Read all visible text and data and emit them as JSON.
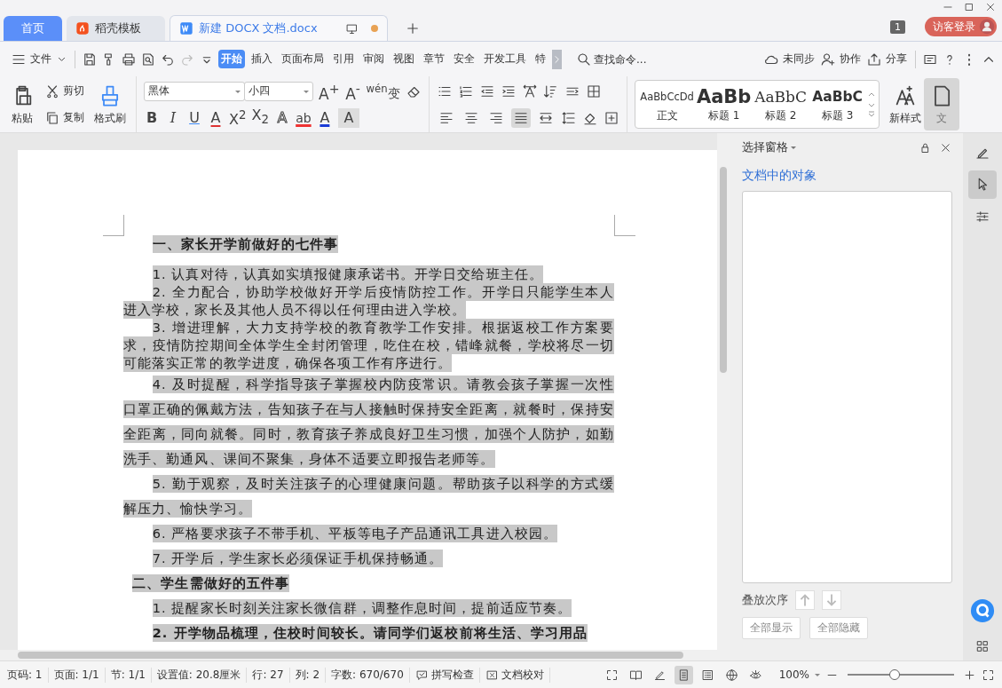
{
  "tabs": [
    {
      "label": "首页",
      "kind": "home",
      "selected": false,
      "modified": false
    },
    {
      "label": "稻壳模板",
      "kind": "template",
      "selected": false,
      "modified": false
    },
    {
      "label": "新建 DOCX 文档.docx",
      "kind": "doc",
      "selected": true,
      "modified": true
    }
  ],
  "window_count": "1",
  "login": "访客登录",
  "menu": {
    "file": "文件",
    "tabs": [
      {
        "label": "开始",
        "selected": true
      },
      {
        "label": "插入",
        "selected": false
      },
      {
        "label": "页面布局",
        "selected": false
      },
      {
        "label": "引用",
        "selected": false
      },
      {
        "label": "审阅",
        "selected": false
      },
      {
        "label": "视图",
        "selected": false
      },
      {
        "label": "章节",
        "selected": false
      },
      {
        "label": "安全",
        "selected": false
      },
      {
        "label": "开发工具",
        "selected": false
      },
      {
        "label": "特",
        "selected": false
      }
    ],
    "search_placeholder": "查找命令...",
    "sync": "未同步",
    "collab": "协作",
    "share": "分享"
  },
  "ribbon": {
    "paste": "粘贴",
    "cut": "剪切",
    "copy": "复制",
    "painter": "格式刷",
    "font": "黑体",
    "size": "小四",
    "font_tools": [
      {
        "kind": "grow",
        "glyph": "A$^{+}$"
      },
      {
        "kind": "shrink",
        "glyph": "A$^{-}$"
      },
      {
        "kind": "pinyin",
        "glyph": "$^{wén}$变"
      }
    ],
    "format": [
      {
        "kind": "bold",
        "glyph": "B"
      },
      {
        "kind": "italic",
        "glyph": "I"
      },
      {
        "kind": "underline",
        "glyph": "U"
      },
      {
        "kind": "strike",
        "glyph": "A"
      },
      {
        "kind": "super",
        "glyph": "X$^{2}$"
      },
      {
        "kind": "sub",
        "glyph": "X$_{2}$"
      },
      {
        "kind": "outline",
        "glyph": "A"
      },
      {
        "kind": "highlight",
        "glyph": "ab"
      },
      {
        "kind": "color",
        "glyph": "A"
      },
      {
        "kind": "shade",
        "glyph": "A"
      }
    ],
    "align": [
      {
        "kind": "left",
        "selected": false
      },
      {
        "kind": "center",
        "selected": false
      },
      {
        "kind": "right",
        "selected": false
      },
      {
        "kind": "justify",
        "selected": true
      },
      {
        "kind": "distribute",
        "selected": false
      }
    ],
    "styles": [
      {
        "sample": "AaBbCcDd",
        "name": "正文",
        "kind": "body"
      },
      {
        "sample": "AaBb",
        "name": "标题 1",
        "kind": "h1"
      },
      {
        "sample": "AaBbC",
        "name": "标题 2",
        "kind": "h2"
      },
      {
        "sample": "AaBbC",
        "name": "标题 3",
        "kind": "h3"
      }
    ],
    "new_style": "新样式",
    "assistant": "文"
  },
  "document": [
    {
      "kind": "heading",
      "text": "一、家长开学前做好的七件事",
      "highlighted": true
    },
    {
      "kind": "item",
      "text": "1. 认真对待，认真如实填报健康承诺书。开学日交给班主任。",
      "highlighted": true
    },
    {
      "kind": "item",
      "text": "2. 全力配合，协助学校做好开学后疫情防控工作。开学日只能学生本人进入学校，家长及其他人员不得以任何理由进入学校。",
      "highlighted": true
    },
    {
      "kind": "item",
      "text": "3. 增进理解，大力支持学校的教育教学工作安排。根据返校工作方案要求，疫情防控期间全体学生全封闭管理，吃住在校，错峰就餐，学校将尽一切可能落实正常的教学进度，确保各项工作有序进行。",
      "highlighted": true
    },
    {
      "kind": "item_loose",
      "text": "4. 及时提醒，科学指导孩子掌握校内防疫常识。请教会孩子掌握一次性口罩正确的佩戴方法，告知孩子在与人接触时保持安全距离，就餐时，保持安全距离，同向就餐。同时，教育孩子养成良好卫生习惯，加强个人防护，如勤洗手、勤通风、课间不聚集，身体不适要立即报告老师等。",
      "highlighted": true
    },
    {
      "kind": "item_loose",
      "text": "5. 勤于观察，及时关注孩子的心理健康问题。帮助孩子以科学的方式缓解压力、愉快学习。",
      "highlighted": true
    },
    {
      "kind": "item_loose",
      "text": "6. 严格要求孩子不带手机、平板等电子产品通讯工具进入校园。",
      "highlighted": true
    },
    {
      "kind": "item_loose",
      "text": "7. 开学后，学生家长必须保证手机保持畅通。",
      "highlighted": true
    },
    {
      "kind": "subheading",
      "text": "二、学生需做好的五件事",
      "highlighted": true
    },
    {
      "kind": "item_loose",
      "text": "1. 提醒家长时刻关注家长微信群，调整作息时间，提前适应节奏。",
      "highlighted": true
    },
    {
      "kind": "item_bold",
      "text": "2. 开学物品梳理，住校时间较长。请同学们返校前将生活、学习用品",
      "highlighted": true
    }
  ],
  "pane": {
    "title": "选择窗格",
    "heading": "文档中的对象",
    "order_label": "叠放次序",
    "buttons": [
      "全部显示",
      "全部隐藏"
    ]
  },
  "status": {
    "items": [
      "页码: 1",
      "页面: 1/1",
      "节: 1/1",
      "设置值: 20.8厘米",
      "行: 27",
      "列: 2",
      "字数: 670/670"
    ],
    "spell": "拼写检查",
    "proof": "文档校对",
    "views": [
      {
        "kind": "fullscreen",
        "selected": false
      },
      {
        "kind": "read",
        "selected": false
      },
      {
        "kind": "write",
        "selected": false
      },
      {
        "kind": "page",
        "selected": true
      },
      {
        "kind": "outline",
        "selected": false
      },
      {
        "kind": "web",
        "selected": false
      },
      {
        "kind": "eye",
        "selected": false
      }
    ],
    "zoom": "100%",
    "zoom_slider": {
      "level": 0.44
    }
  },
  "side": [
    {
      "kind": "pen",
      "selected": false
    },
    {
      "kind": "cursor",
      "selected": true
    },
    {
      "kind": "sliders",
      "selected": false
    }
  ]
}
